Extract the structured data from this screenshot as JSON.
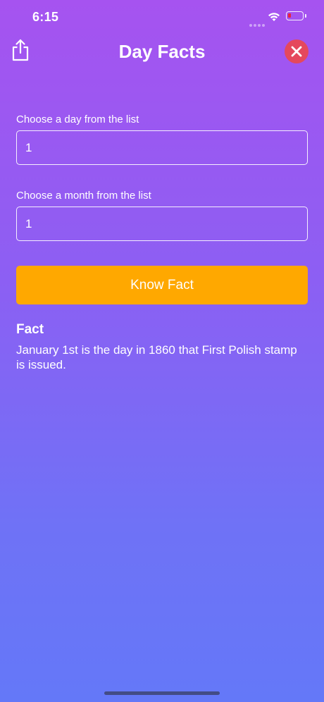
{
  "status_bar": {
    "time": "6:15",
    "battery_color": "#e8223f"
  },
  "nav": {
    "title": "Day Facts",
    "share_icon": "share-icon",
    "close_icon": "close-icon",
    "close_color": "#e5485c"
  },
  "form": {
    "day_label": "Choose a day from the list",
    "day_value": "1",
    "month_label": "Choose a month from the list",
    "month_value": "1",
    "button_label": "Know Fact",
    "button_color": "#ffa800"
  },
  "fact": {
    "heading": "Fact",
    "text": "January 1st is the day in 1860 that First Polish stamp is issued."
  }
}
